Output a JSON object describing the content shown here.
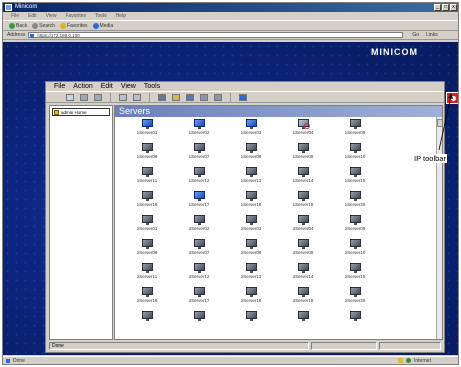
{
  "browser": {
    "title": "Minicom",
    "title_buttons": [
      "_",
      "□",
      "x"
    ],
    "menu": [
      "File",
      "Edit",
      "View",
      "Favorites",
      "Tools",
      "Help"
    ],
    "toolbar": [
      {
        "label": "Back",
        "icon": "back-arrow-icon"
      },
      {
        "label": "Search",
        "icon": "search-icon"
      },
      {
        "label": "Favorites",
        "icon": "favorites-star-icon"
      },
      {
        "label": "Media",
        "icon": "media-icon"
      }
    ],
    "address_label": "Address",
    "address_value": "https://172.168.0.100",
    "go_label": "Go",
    "links_label": "Links",
    "status_left": "Done",
    "status_right": "Internet"
  },
  "desktop": {
    "brand": "MINICOM"
  },
  "app": {
    "menu": [
      "File",
      "Action",
      "Edit",
      "View",
      "Tools"
    ],
    "tree_root": "admin Home",
    "panel_title": "Servers",
    "status_text": "Done",
    "servers": [
      "1Server01",
      "1Server02",
      "1Server03",
      "1Server04",
      "1Server05",
      "1Server06",
      "1Server07",
      "1Server08",
      "1Server09",
      "1Server10",
      "1Server11",
      "1Server12",
      "1Server13",
      "1Server14",
      "1Server15",
      "1Server16",
      "1Server17",
      "1Server18",
      "1Server19",
      "1Server20",
      "2Server01",
      "2Server02",
      "2Server03",
      "2Server04",
      "2Server05",
      "2Server06",
      "2Server07",
      "2Server08",
      "2Server09",
      "2Server10",
      "2Server11",
      "2Server12",
      "2Server13",
      "2Server14",
      "2Server15",
      "2Server16",
      "2Server17",
      "2Server18",
      "2Server19",
      "2Server20",
      "",
      "",
      "",
      "",
      ""
    ],
    "active_servers": [
      0,
      1,
      2,
      16
    ],
    "search_server": 3
  },
  "callout": {
    "label": "IP toolbar"
  },
  "colors": {
    "desktop_blue": "#0c2580",
    "panel_header": "#6c7fb8",
    "ip_toolbar_red": "#e02020"
  }
}
